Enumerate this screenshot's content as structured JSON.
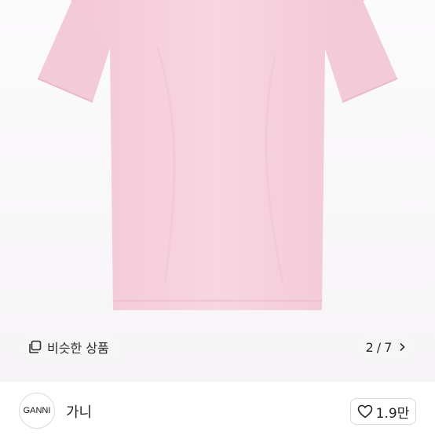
{
  "gallery": {
    "image_alt": "pink t-shirt back view",
    "shirt_color": "#f5cfdc",
    "similar_label": "비슷한 상품",
    "current_page": "2",
    "page_separator": "/",
    "total_pages": "7",
    "pager_icon": "chevron-right-icon",
    "similar_icon": "similar-items-icon"
  },
  "seller": {
    "avatar_text": "GANNI",
    "name": "가니",
    "like_icon": "heart-outline-icon",
    "like_count": "1.9만"
  }
}
